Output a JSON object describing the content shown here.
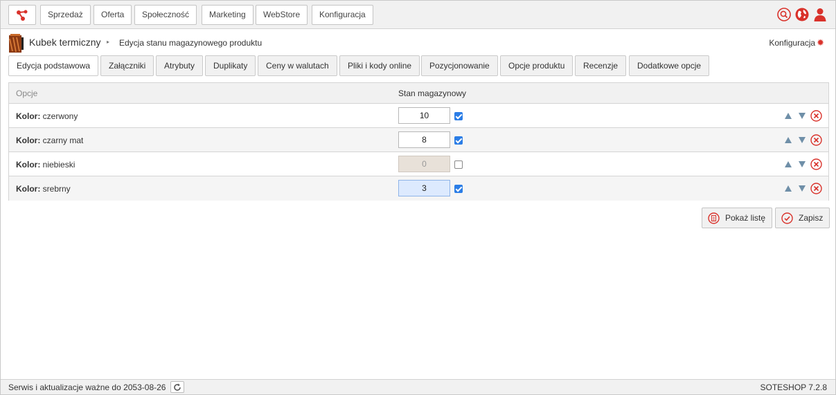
{
  "nav": {
    "items": [
      "Sprzedaż",
      "Oferta",
      "Społeczność",
      "Marketing",
      "WebStore",
      "Konfiguracja"
    ]
  },
  "header": {
    "product_name": "Kubek termiczny",
    "breadcrumb_sep": "▸",
    "page_title": "Edycja stanu magazynowego produktu",
    "config_label": "Konfiguracja"
  },
  "tabs": [
    "Edycja podstawowa",
    "Załączniki",
    "Atrybuty",
    "Duplikaty",
    "Ceny w walutach",
    "Pliki i kody online",
    "Pozycjonowanie",
    "Opcje produktu",
    "Recenzje",
    "Dodatkowe opcje"
  ],
  "table": {
    "col_options": "Opcje",
    "col_stock": "Stan magazynowy",
    "rows": [
      {
        "key": "Kolor:",
        "value": "czerwony",
        "qty": "10",
        "checked": true,
        "state": "normal"
      },
      {
        "key": "Kolor:",
        "value": "czarny mat",
        "qty": "8",
        "checked": true,
        "state": "normal"
      },
      {
        "key": "Kolor:",
        "value": "niebieski",
        "qty": "0",
        "checked": false,
        "state": "disabled"
      },
      {
        "key": "Kolor:",
        "value": "srebrny",
        "qty": "3",
        "checked": true,
        "state": "focused"
      }
    ]
  },
  "actions": {
    "list_label": "Pokaż listę",
    "save_label": "Zapisz"
  },
  "footer": {
    "service_text": "Serwis i aktualizacje ważne do 2053-08-26",
    "version": "SOTESHOP 7.2.8"
  },
  "colors": {
    "accent": "#d9322b",
    "checkbox": "#2b7de6",
    "arrow": "#6f8fa8"
  }
}
